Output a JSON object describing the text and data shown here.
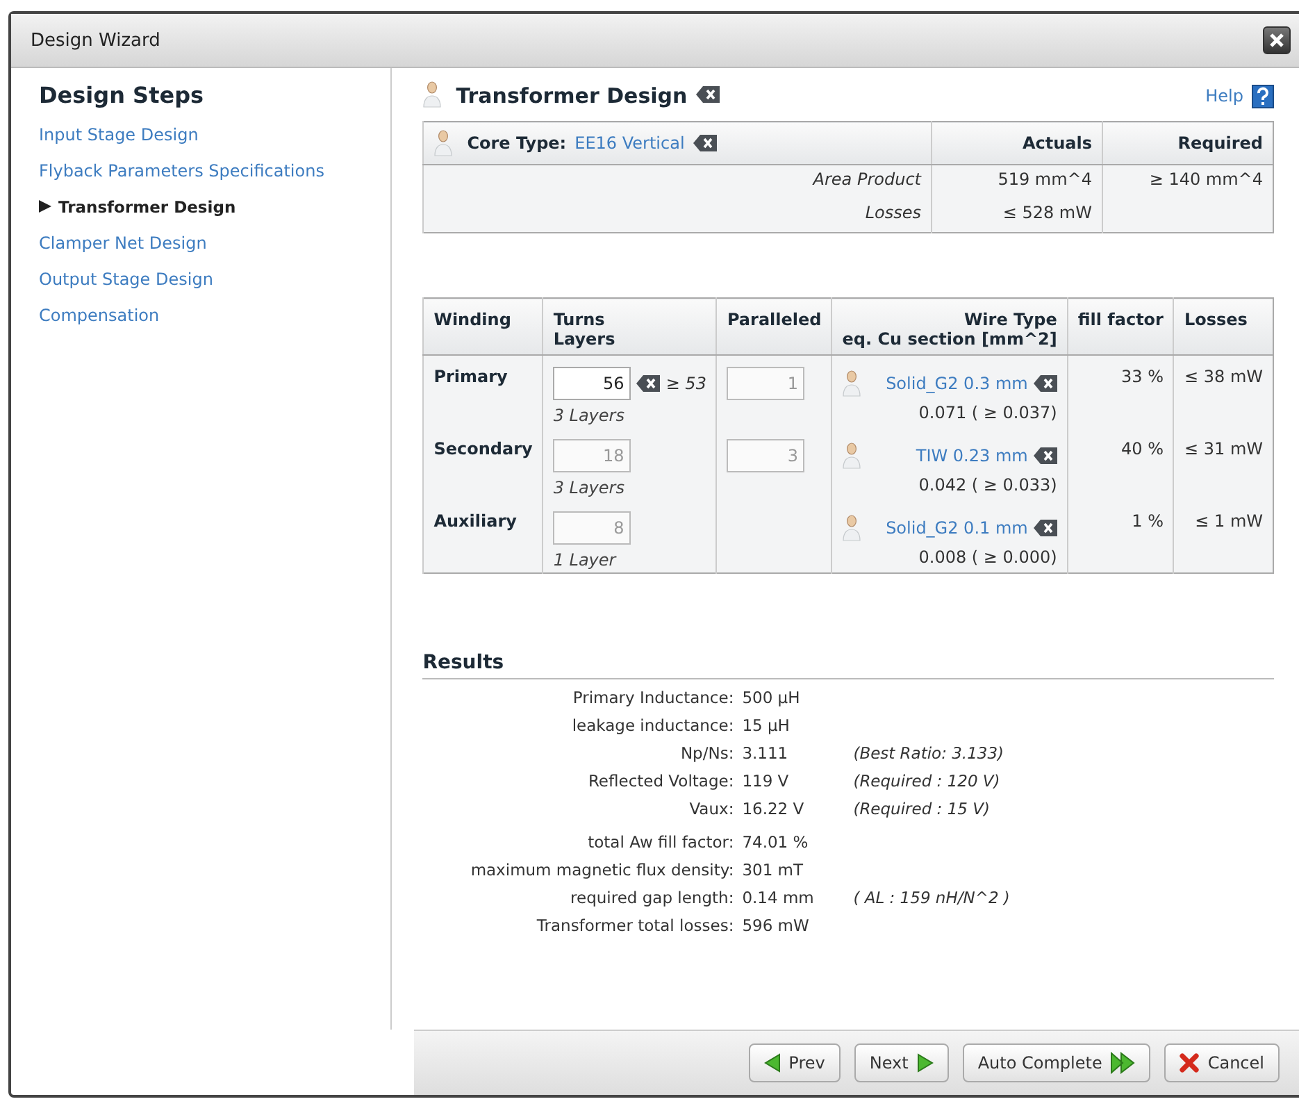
{
  "window": {
    "title": "Design Wizard"
  },
  "sidebar": {
    "title": "Design Steps",
    "items": [
      {
        "label": "Input Stage Design",
        "selected": false
      },
      {
        "label": "Flyback Parameters Specifications",
        "selected": false
      },
      {
        "label": "Transformer Design",
        "selected": true
      },
      {
        "label": "Clamper Net Design",
        "selected": false
      },
      {
        "label": "Output Stage Design",
        "selected": false
      },
      {
        "label": "Compensation",
        "selected": false
      }
    ]
  },
  "header": {
    "title": "Transformer Design",
    "help": "Help"
  },
  "core_table": {
    "label": "Core Type:",
    "value": "EE16 Vertical",
    "columns": [
      "Actuals",
      "Required"
    ],
    "rows": [
      {
        "name": "Area Product",
        "actual": "519 mm^4",
        "required": "≥ 140 mm^4"
      },
      {
        "name": "Losses",
        "actual": "≤ 528 mW",
        "required": ""
      }
    ]
  },
  "winding_table": {
    "columns": [
      {
        "lines": [
          "Winding"
        ]
      },
      {
        "lines": [
          "Turns",
          "Layers"
        ]
      },
      {
        "lines": [
          "Paralleled"
        ]
      },
      {
        "lines": [
          "Wire Type",
          "eq. Cu section [mm^2]"
        ]
      },
      {
        "lines": [
          "fill factor"
        ]
      },
      {
        "lines": [
          "Losses"
        ]
      }
    ],
    "rows": [
      {
        "name": "Primary",
        "turns": "56",
        "turns_disabled": false,
        "turns_min": "≥ 53",
        "layers": "3 Layers",
        "paralleled": "1",
        "wire": "Solid_G2 0.3 mm",
        "section": "0.071 ( ≥ 0.037)",
        "fill": "33 %",
        "losses": "≤ 38 mW"
      },
      {
        "name": "Secondary",
        "turns": "18",
        "turns_disabled": true,
        "layers": "3 Layers",
        "paralleled": "3",
        "wire": "TIW 0.23 mm",
        "section": "0.042 ( ≥ 0.033)",
        "fill": "40 %",
        "losses": "≤ 31 mW"
      },
      {
        "name": "Auxiliary",
        "turns": "8",
        "turns_disabled": true,
        "layers": "1 Layer",
        "wire": "Solid_G2 0.1 mm",
        "section": "0.008 ( ≥ 0.000)",
        "fill": "1 %",
        "losses": "≤ 1 mW"
      }
    ]
  },
  "results": {
    "title": "Results",
    "groups": [
      {
        "rows": [
          {
            "label": "Primary Inductance:",
            "value": "500 µH"
          },
          {
            "label": "leakage inductance:",
            "value": "15 µH"
          },
          {
            "label": "Np/Ns:",
            "value": "3.111",
            "note": "(Best Ratio: 3.133)"
          },
          {
            "label": "Reflected Voltage:",
            "value": "119 V",
            "note": "(Required : 120 V)"
          },
          {
            "label": "Vaux:",
            "value": "16.22 V",
            "note": "(Required : 15 V)"
          }
        ]
      },
      {
        "rows": [
          {
            "label": "total Aw fill factor:",
            "value": "74.01 %"
          },
          {
            "label": "maximum magnetic flux density:",
            "value": "301 mT"
          },
          {
            "label": "required gap length:",
            "value": "0.14 mm",
            "note": "( AL : 159 nH/N^2 )"
          },
          {
            "label": "Transformer total losses:",
            "value": "596 mW"
          }
        ]
      }
    ]
  },
  "buttons": [
    {
      "label": "Prev",
      "kind": "prev"
    },
    {
      "label": "Next",
      "kind": "next"
    },
    {
      "label": "Auto Complete",
      "kind": "auto"
    },
    {
      "label": "Cancel",
      "kind": "cancel"
    }
  ]
}
